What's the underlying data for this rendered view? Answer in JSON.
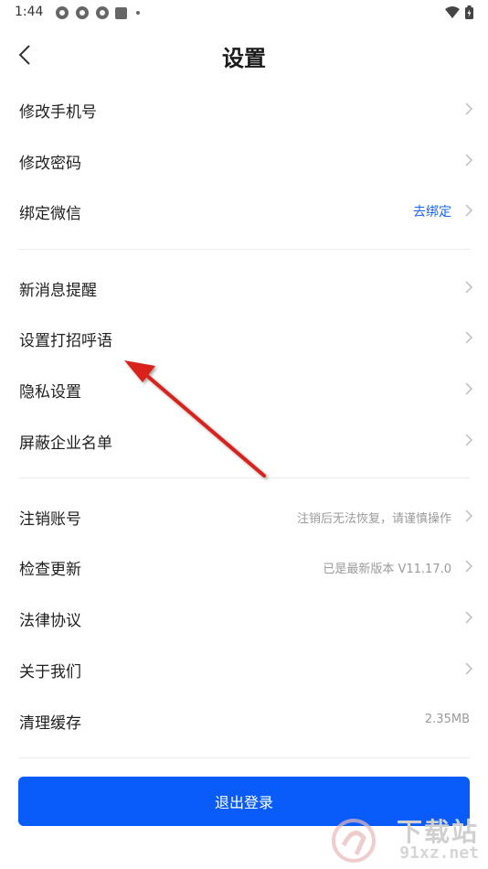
{
  "status_bar": {
    "time": "1:44"
  },
  "header": {
    "title": "设置",
    "back_icon": "chevron-left-icon"
  },
  "settings_groups": {
    "account": [
      {
        "label": "修改手机号",
        "value": ""
      },
      {
        "label": "修改密码",
        "value": ""
      },
      {
        "label": "绑定微信",
        "value": "去绑定"
      }
    ],
    "general": [
      {
        "label": "新消息提醒",
        "value": ""
      },
      {
        "label": "设置打招呼语",
        "value": ""
      },
      {
        "label": "隐私设置",
        "value": ""
      },
      {
        "label": "屏蔽企业名单",
        "value": ""
      }
    ],
    "other": [
      {
        "label": "注销账号",
        "value": "注销后无法恢复，请谨慎操作"
      },
      {
        "label": "检查更新",
        "value": "已是最新版本 V11.17.0"
      },
      {
        "label": "法律协议",
        "value": ""
      },
      {
        "label": "关于我们",
        "value": ""
      },
      {
        "label": "清理缓存",
        "value": "2.35MB"
      }
    ]
  },
  "logout_label": "退出登录",
  "watermark": {
    "brand": "下载站",
    "url": "91xz.net"
  },
  "colors": {
    "accent": "#0a5cfa",
    "link": "#1a64f0",
    "annotation_arrow": "#d9201f"
  }
}
